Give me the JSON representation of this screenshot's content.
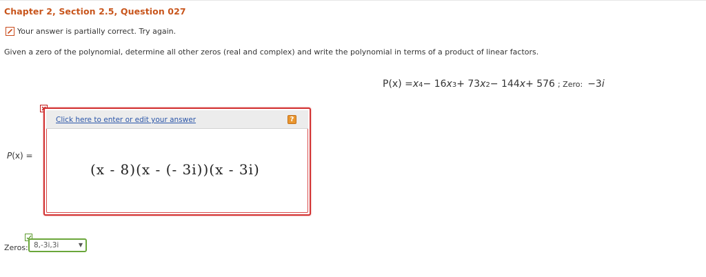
{
  "header": {
    "title": "Chapter 2, Section 2.5, Question 027"
  },
  "status": {
    "message": "Your answer is partially correct.  Try again."
  },
  "question": {
    "text": "Given a zero of the polynomial, determine all other zeros (real and complex) and write the polynomial in terms of a product of linear factors."
  },
  "polynomial": {
    "lhs": "P(x) = ",
    "terms": {
      "t1_var": "x",
      "t1_exp": "4",
      "t2": " − 16",
      "t2_var": "x",
      "t2_exp": "3",
      "t3": " + 73",
      "t3_var": "x",
      "t3_exp": "2",
      "t4": " − 144",
      "t4_var": "x",
      "t5": " + 576"
    },
    "zero_label": "; Zero:",
    "zero_value": "−3",
    "zero_unit": "i"
  },
  "answer_box": {
    "link_label": "Click here to enter or edit your answer",
    "help_label": "?",
    "expression": "(x - 8)(x - (- 3i))(x - 3i)"
  },
  "px_label": {
    "p": "P",
    "arg": "(x)",
    "eq": " ="
  },
  "zeros": {
    "label": "Zeros:",
    "value": "8,-3i,3i",
    "caret": "▼"
  },
  "colors": {
    "heading": "#c8551c",
    "incorrect_border": "#d23030",
    "correct_border": "#6aa63a",
    "link": "#2a55a8",
    "help": "#e9962e"
  }
}
